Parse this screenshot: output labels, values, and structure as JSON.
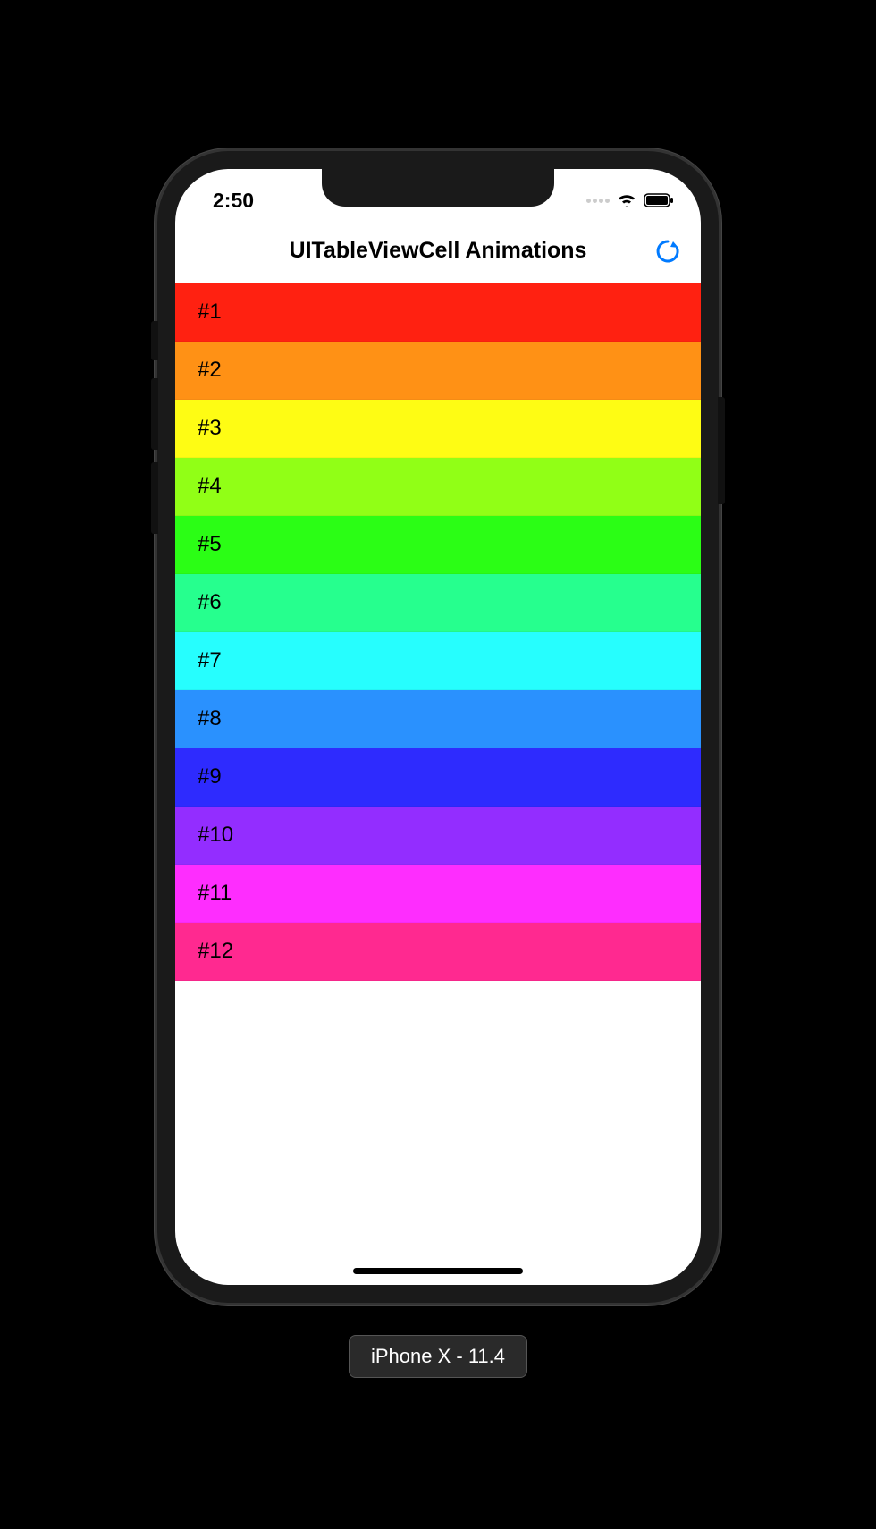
{
  "status_bar": {
    "time": "2:50"
  },
  "nav": {
    "title": "UITableViewCell Animations"
  },
  "accent_color": "#007AFF",
  "table": {
    "rows": [
      {
        "label": "#1",
        "color": "#FF2111"
      },
      {
        "label": "#2",
        "color": "#FF9115"
      },
      {
        "label": "#3",
        "color": "#FEFC14"
      },
      {
        "label": "#4",
        "color": "#91FF16"
      },
      {
        "label": "#5",
        "color": "#2BFE15"
      },
      {
        "label": "#6",
        "color": "#26FF8E"
      },
      {
        "label": "#7",
        "color": "#26FEFE"
      },
      {
        "label": "#8",
        "color": "#2A91FE"
      },
      {
        "label": "#9",
        "color": "#2E2BFE"
      },
      {
        "label": "#10",
        "color": "#932DFF"
      },
      {
        "label": "#11",
        "color": "#FE2DFE"
      },
      {
        "label": "#12",
        "color": "#FF2990"
      }
    ]
  },
  "device_label": "iPhone X - 11.4"
}
